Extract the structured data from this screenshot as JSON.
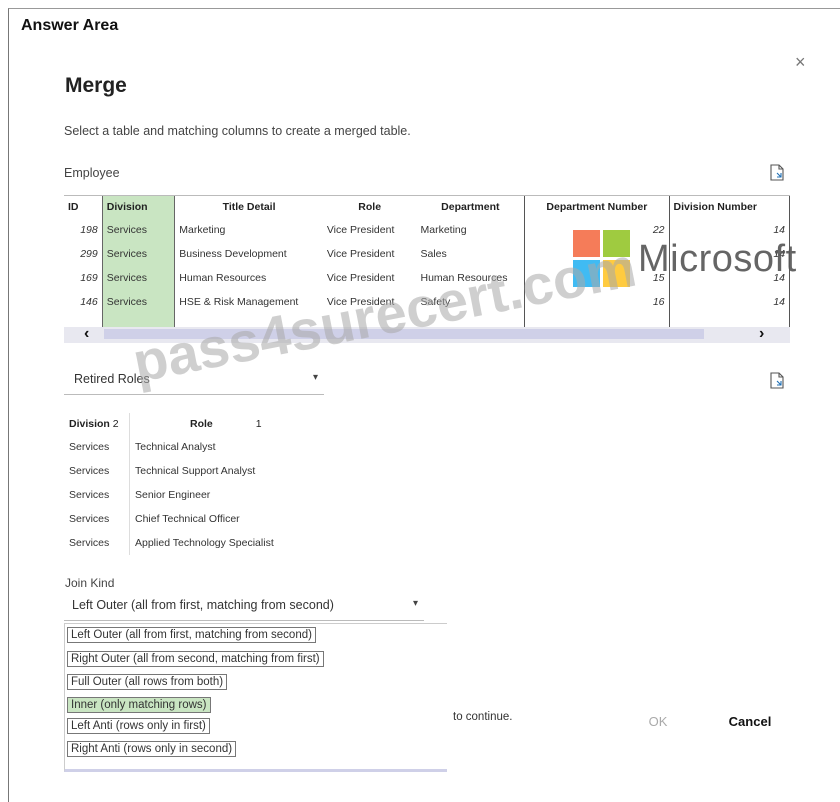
{
  "answer_area": "Answer Area",
  "dialog": {
    "title": "Merge",
    "subtitle": "Select a table and matching columns to create a merged table.",
    "close_glyph": "×"
  },
  "employee_table": {
    "label": "Employee",
    "headers": [
      "ID",
      "Division",
      "Title Detail",
      "Role",
      "Department",
      "Department Number",
      "Division Number"
    ],
    "rows": [
      [
        "198",
        "Services",
        "Marketing",
        "Vice President",
        "Marketing",
        "22",
        "14"
      ],
      [
        "299",
        "Services",
        "Business Development",
        "Vice President",
        "Sales",
        "",
        "14"
      ],
      [
        "169",
        "Services",
        "Human Resources",
        "Vice President",
        "Human Resources",
        "15",
        "14"
      ],
      [
        "146",
        "Services",
        "HSE & Risk Management",
        "Vice President",
        "Safety",
        "16",
        "14"
      ]
    ],
    "scroll_left": "‹",
    "scroll_right": "›"
  },
  "second_table": {
    "selected": "Retired Roles",
    "headers": [
      "Division",
      "2",
      "Role",
      "1"
    ],
    "rows": [
      [
        "Services",
        "Technical Analyst"
      ],
      [
        "Services",
        "Technical Support Analyst"
      ],
      [
        "Services",
        "Senior Engineer"
      ],
      [
        "Services",
        "Chief Technical Officer"
      ],
      [
        "Services",
        "Applied Technology Specialist"
      ]
    ]
  },
  "join_kind": {
    "label": "Join Kind",
    "selected": "Left Outer (all from first, matching from second)",
    "options": [
      "Left Outer (all from first, matching from second)",
      "Right Outer (all from second, matching from first)",
      "Full Outer (all rows from both)",
      "Inner (only matching rows)",
      "Left Anti (rows only in first)",
      "Right Anti (rows only in second)"
    ]
  },
  "footer": {
    "continue_text": "to continue.",
    "ok_label": "OK",
    "cancel_label": "Cancel"
  },
  "watermarks": {
    "microsoft": "Microsoft",
    "site": "pass4surecert.com"
  },
  "colors": {
    "selected_column": "#c9e5c2",
    "logo_red": "#f25022",
    "logo_green": "#7fba00",
    "logo_blue": "#00a4ef",
    "logo_yellow": "#ffb900"
  }
}
